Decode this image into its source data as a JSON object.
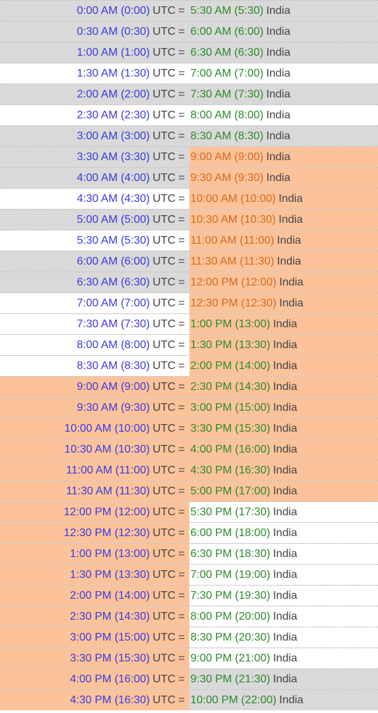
{
  "labels": {
    "utc": "UTC",
    "india": "India",
    "eq": "="
  },
  "rows": [
    {
      "utc_time": "0:00 AM (0:00)",
      "utc_bg": "gray",
      "india_time": "5:30 AM (5:30)",
      "india_bg": "gray",
      "india_color": "green"
    },
    {
      "utc_time": "0:30 AM (0:30)",
      "utc_bg": "gray",
      "india_time": "6:00 AM (6:00)",
      "india_bg": "gray",
      "india_color": "green"
    },
    {
      "utc_time": "1:00 AM (1:00)",
      "utc_bg": "gray",
      "india_time": "6:30 AM (6:30)",
      "india_bg": "gray",
      "india_color": "green"
    },
    {
      "utc_time": "1:30 AM (1:30)",
      "utc_bg": "white",
      "india_time": "7:00 AM (7:00)",
      "india_bg": "white",
      "india_color": "green"
    },
    {
      "utc_time": "2:00 AM (2:00)",
      "utc_bg": "gray",
      "india_time": "7:30 AM (7:30)",
      "india_bg": "gray",
      "india_color": "green"
    },
    {
      "utc_time": "2:30 AM (2:30)",
      "utc_bg": "white",
      "india_time": "8:00 AM (8:00)",
      "india_bg": "white",
      "india_color": "green"
    },
    {
      "utc_time": "3:00 AM (3:00)",
      "utc_bg": "gray",
      "india_time": "8:30 AM (8:30)",
      "india_bg": "gray",
      "india_color": "green"
    },
    {
      "utc_time": "3:30 AM (3:30)",
      "utc_bg": "gray",
      "india_time": "9:00 AM (9:00)",
      "india_bg": "orange",
      "india_color": "orange"
    },
    {
      "utc_time": "4:00 AM (4:00)",
      "utc_bg": "gray",
      "india_time": "9:30 AM (9:30)",
      "india_bg": "orange",
      "india_color": "orange"
    },
    {
      "utc_time": "4:30 AM (4:30)",
      "utc_bg": "white",
      "india_time": "10:00 AM (10:00)",
      "india_bg": "orange",
      "india_color": "orange"
    },
    {
      "utc_time": "5:00 AM (5:00)",
      "utc_bg": "gray",
      "india_time": "10:30 AM (10:30)",
      "india_bg": "orange",
      "india_color": "orange"
    },
    {
      "utc_time": "5:30 AM (5:30)",
      "utc_bg": "white",
      "india_time": "11:00 AM (11:00)",
      "india_bg": "orange",
      "india_color": "orange"
    },
    {
      "utc_time": "6:00 AM (6:00)",
      "utc_bg": "gray",
      "india_time": "11:30 AM (11:30)",
      "india_bg": "orange",
      "india_color": "orange"
    },
    {
      "utc_time": "6:30 AM (6:30)",
      "utc_bg": "gray",
      "india_time": "12:00 PM (12:00)",
      "india_bg": "orange",
      "india_color": "orange"
    },
    {
      "utc_time": "7:00 AM (7:00)",
      "utc_bg": "white",
      "india_time": "12:30 PM (12:30)",
      "india_bg": "orange",
      "india_color": "orange"
    },
    {
      "utc_time": "7:30 AM (7:30)",
      "utc_bg": "white",
      "india_time": "1:00 PM (13:00)",
      "india_bg": "orange",
      "india_color": "green"
    },
    {
      "utc_time": "8:00 AM (8:00)",
      "utc_bg": "white",
      "india_time": "1:30 PM (13:30)",
      "india_bg": "orange",
      "india_color": "green"
    },
    {
      "utc_time": "8:30 AM (8:30)",
      "utc_bg": "white",
      "india_time": "2:00 PM (14:00)",
      "india_bg": "orange",
      "india_color": "green"
    },
    {
      "utc_time": "9:00 AM (9:00)",
      "utc_bg": "orange",
      "india_time": "2:30 PM (14:30)",
      "india_bg": "orange",
      "india_color": "green"
    },
    {
      "utc_time": "9:30 AM (9:30)",
      "utc_bg": "orange",
      "india_time": "3:00 PM (15:00)",
      "india_bg": "orange",
      "india_color": "green"
    },
    {
      "utc_time": "10:00 AM (10:00)",
      "utc_bg": "orange",
      "india_time": "3:30 PM (15:30)",
      "india_bg": "orange",
      "india_color": "green"
    },
    {
      "utc_time": "10:30 AM (10:30)",
      "utc_bg": "orange",
      "india_time": "4:00 PM (16:00)",
      "india_bg": "orange",
      "india_color": "green"
    },
    {
      "utc_time": "11:00 AM (11:00)",
      "utc_bg": "orange",
      "india_time": "4:30 PM (16:30)",
      "india_bg": "orange",
      "india_color": "green"
    },
    {
      "utc_time": "11:30 AM (11:30)",
      "utc_bg": "orange",
      "india_time": "5:00 PM (17:00)",
      "india_bg": "orange",
      "india_color": "green"
    },
    {
      "utc_time": "12:00 PM (12:00)",
      "utc_bg": "orange",
      "india_time": "5:30 PM (17:30)",
      "india_bg": "white",
      "india_color": "green"
    },
    {
      "utc_time": "12:30 PM (12:30)",
      "utc_bg": "orange",
      "india_time": "6:00 PM (18:00)",
      "india_bg": "white",
      "india_color": "green"
    },
    {
      "utc_time": "1:00 PM (13:00)",
      "utc_bg": "orange",
      "india_time": "6:30 PM (18:30)",
      "india_bg": "white",
      "india_color": "green"
    },
    {
      "utc_time": "1:30 PM (13:30)",
      "utc_bg": "orange",
      "india_time": "7:00 PM (19:00)",
      "india_bg": "white",
      "india_color": "green"
    },
    {
      "utc_time": "2:00 PM (14:00)",
      "utc_bg": "orange",
      "india_time": "7:30 PM (19:30)",
      "india_bg": "white",
      "india_color": "green"
    },
    {
      "utc_time": "2:30 PM (14:30)",
      "utc_bg": "orange",
      "india_time": "8:00 PM (20:00)",
      "india_bg": "white",
      "india_color": "green"
    },
    {
      "utc_time": "3:00 PM (15:00)",
      "utc_bg": "orange",
      "india_time": "8:30 PM (20:30)",
      "india_bg": "white",
      "india_color": "green"
    },
    {
      "utc_time": "3:30 PM (15:30)",
      "utc_bg": "orange",
      "india_time": "9:00 PM (21:00)",
      "india_bg": "white",
      "india_color": "green"
    },
    {
      "utc_time": "4:00 PM (16:00)",
      "utc_bg": "orange",
      "india_time": "9:30 PM (21:30)",
      "india_bg": "gray",
      "india_color": "green"
    },
    {
      "utc_time": "4:30 PM (16:30)",
      "utc_bg": "orange",
      "india_time": "10:00 PM (22:00)",
      "india_bg": "gray",
      "india_color": "green"
    }
  ]
}
